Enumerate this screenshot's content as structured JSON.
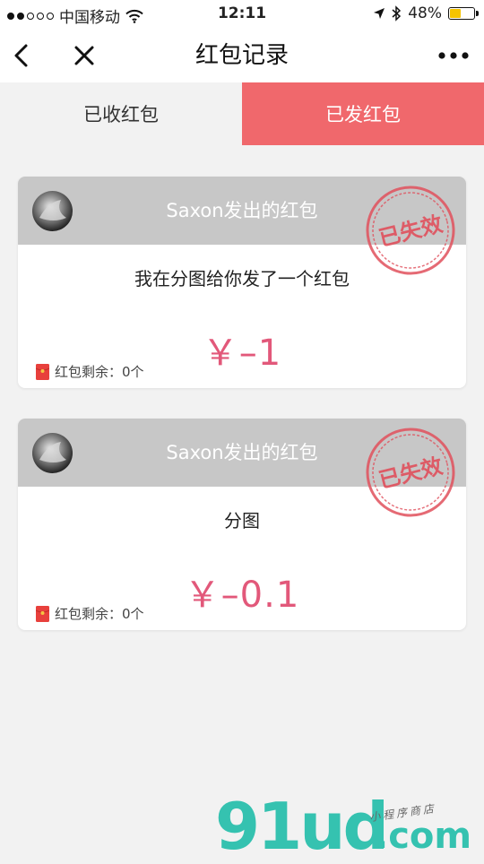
{
  "status_bar": {
    "carrier": "中国移动",
    "time": "12:11",
    "battery": "48%",
    "battery_level": 0.48
  },
  "nav": {
    "title": "红包记录"
  },
  "tabs": [
    {
      "label": "已收红包",
      "active": false
    },
    {
      "label": "已发红包",
      "active": true
    }
  ],
  "records": [
    {
      "title": "Saxon发出的红包",
      "message": "我在分图给你发了一个红包",
      "amount": "￥–1",
      "remaining": "红包剩余：0个",
      "stamp": "已失效"
    },
    {
      "title": "Saxon发出的红包",
      "message": "分图",
      "amount": "￥–0.1",
      "remaining": "红包剩余：0个",
      "stamp": "已失效"
    }
  ],
  "watermark": {
    "brand": "91ud",
    "domain": ".com",
    "tagline": "小程序商店"
  },
  "colors": {
    "accent": "#f0686c",
    "amount": "#e2587a",
    "header_gray": "#c7c7c7",
    "stamp": "#e0505c",
    "watermark": "#35c2b0"
  }
}
